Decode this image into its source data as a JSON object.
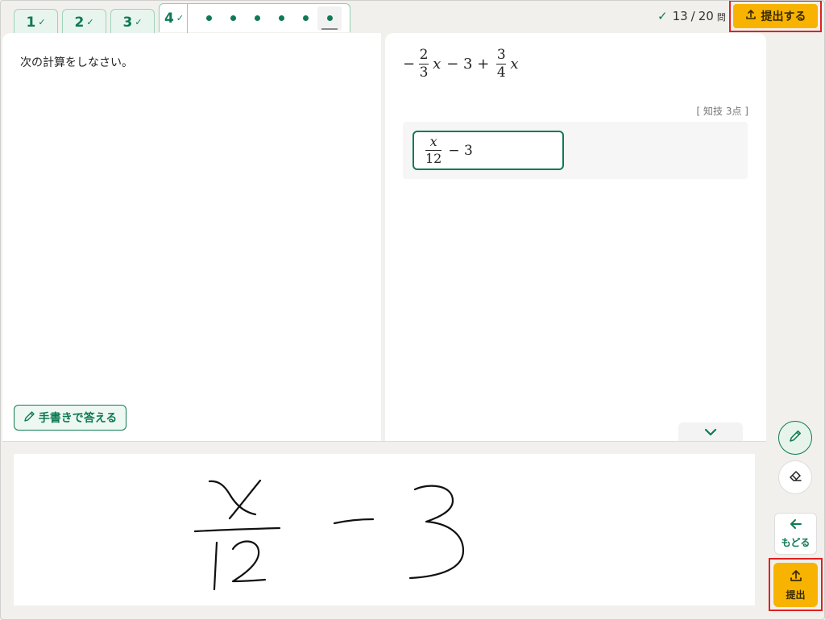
{
  "tabs": [
    {
      "label": "1",
      "done": true
    },
    {
      "label": "2",
      "done": true
    },
    {
      "label": "3",
      "done": true
    },
    {
      "label": "4",
      "done": true
    }
  ],
  "check_mark": "✓",
  "dots_count": 6,
  "progress": {
    "answered": "13",
    "separator": "/",
    "total": "20",
    "unit": "問"
  },
  "submit_top_label": "提出する",
  "instruction": "次の計算をしなさい。",
  "problem": {
    "sign_minus": "−",
    "frac1": {
      "num": "2",
      "den": "3"
    },
    "var1": "x",
    "op1": "− 3 +",
    "frac2": {
      "num": "3",
      "den": "4"
    },
    "var2": "x"
  },
  "points_label": "[ 知技 3点 ]",
  "answer": {
    "frac": {
      "num": "x",
      "den": "12"
    },
    "rest": "− 3"
  },
  "handwrite_label": "手書きで答える",
  "back_label": "もどる",
  "submit_side_label": "提出",
  "colors": {
    "accent": "#0f7a52",
    "submit": "#f7b300",
    "highlight": "#e0211f"
  },
  "icons": {
    "pen": "pencil-icon",
    "eraser": "eraser-icon",
    "back": "arrow-left-icon",
    "upload": "upload-icon"
  }
}
